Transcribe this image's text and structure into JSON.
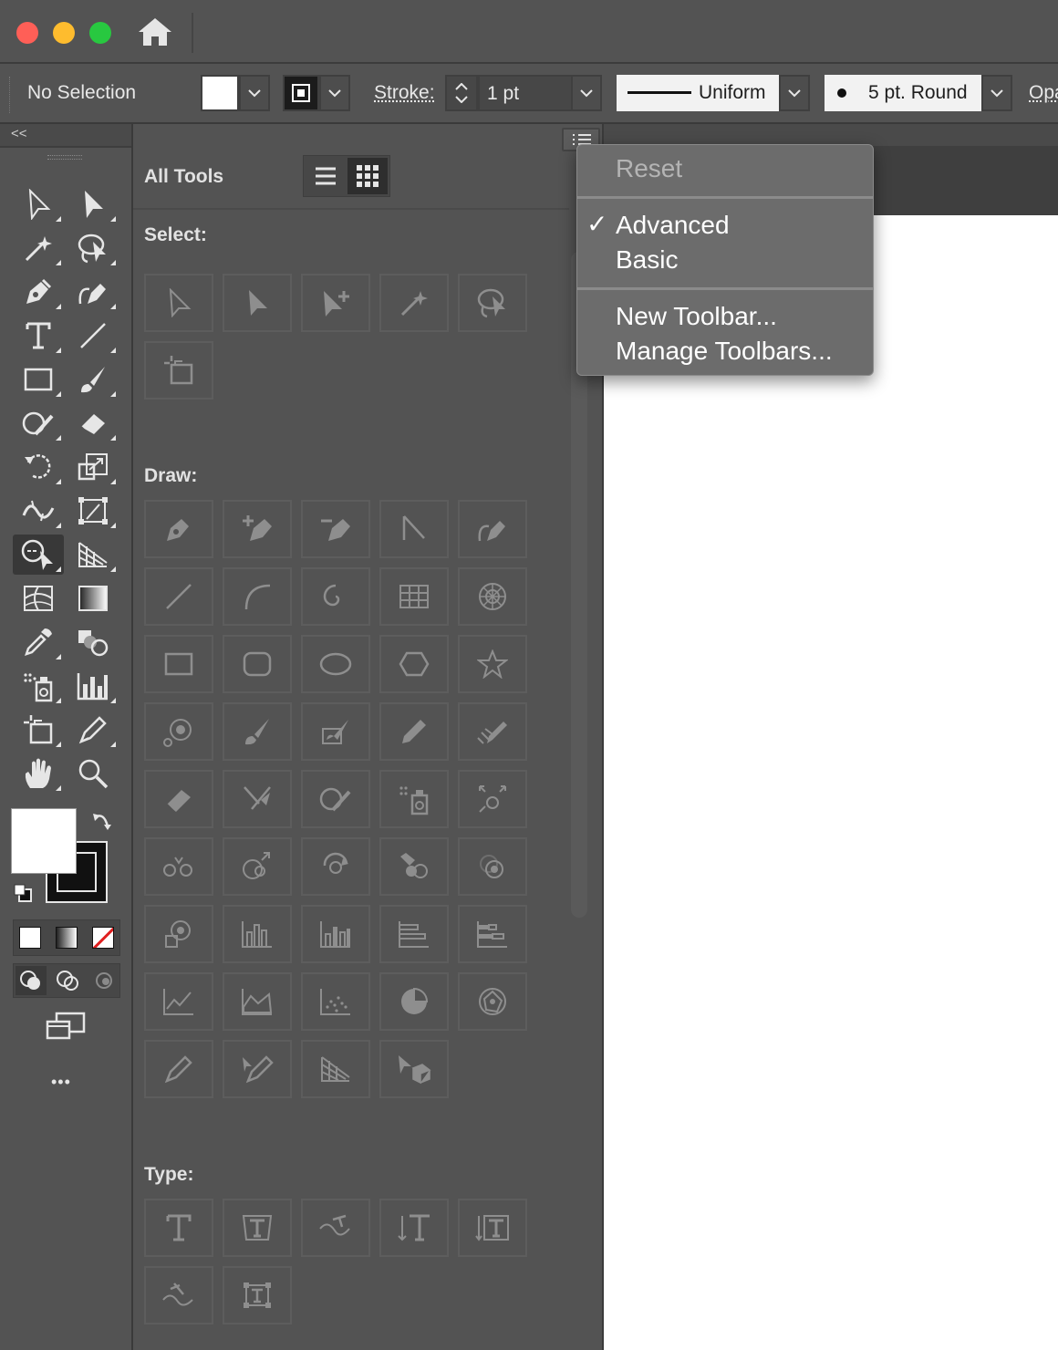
{
  "title_bar": {
    "traffic_lights": {
      "close": "#ff5f57",
      "minimize": "#febc2e",
      "zoom": "#28c840"
    },
    "home_icon": "home-icon"
  },
  "control_bar": {
    "selection_status": "No Selection",
    "fill_swatch_color": "#ffffff",
    "stroke_label": "Stroke:",
    "stroke_weight": "1 pt",
    "stroke_profile": "Uniform",
    "brush_definition": "5 pt. Round",
    "opacity_label": "Opa"
  },
  "all_tools_panel": {
    "title": "All Tools",
    "view_modes": [
      "list-view-icon",
      "grid-view-icon"
    ],
    "sections": [
      {
        "label": "Select:",
        "tool_icons": [
          "direct-selection",
          "selection",
          "magic-wand",
          "artboard"
        ]
      },
      {
        "label": "Draw:",
        "tool_icons": [
          "pen",
          "line",
          "rectangle",
          "blob-brush",
          "symbol-sprayer",
          "graph",
          "pencil",
          "perspective-grid"
        ]
      },
      {
        "label": "Type:",
        "tool_icons": [
          "type",
          "area-type",
          "type-on-path",
          "vertical-type",
          "touch-type"
        ]
      }
    ]
  },
  "flyout_menu": {
    "items": [
      {
        "label": "Reset",
        "enabled": false
      },
      {
        "label": "Advanced",
        "checked": true
      },
      {
        "label": "Basic"
      },
      {
        "label": "New Toolbar..."
      },
      {
        "label": "Manage Toolbars..."
      }
    ],
    "checkmark": "✓"
  },
  "toolbar": {
    "collapse_glyph": "<<",
    "more_glyph": "•••"
  }
}
